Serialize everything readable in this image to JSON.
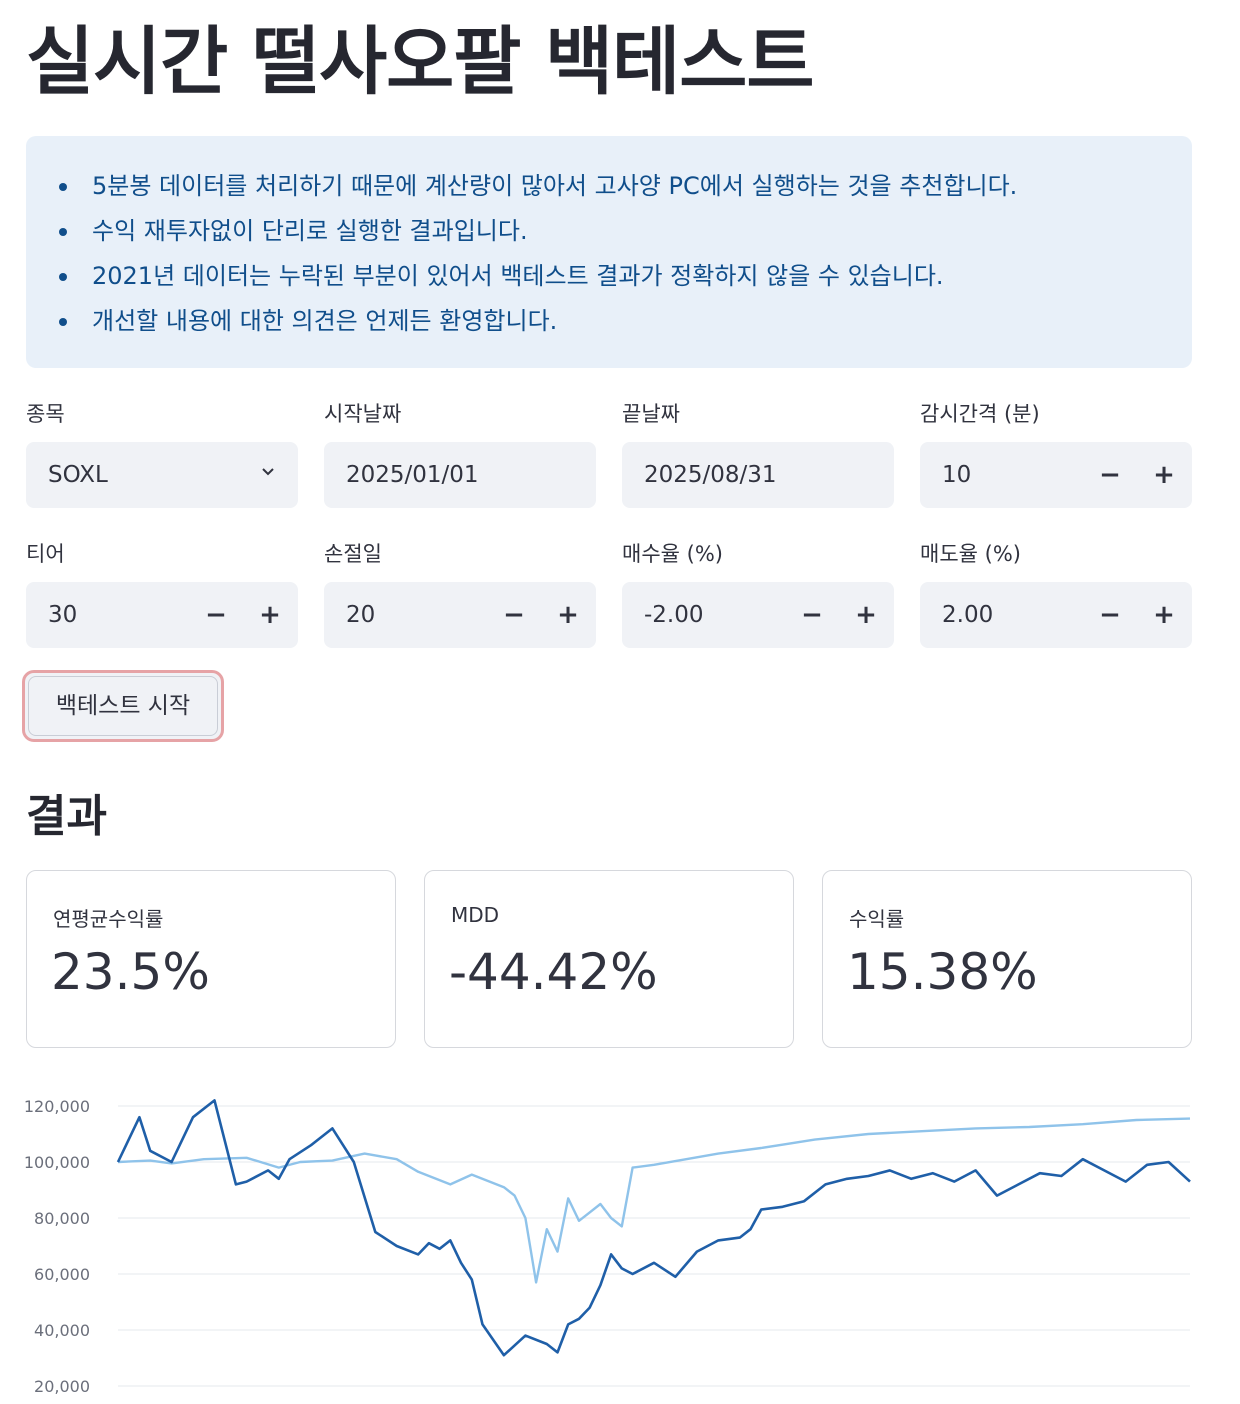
{
  "page": {
    "title": "실시간 떨사오팔 백테스트"
  },
  "info": {
    "items": [
      "5분봉 데이터를 처리하기 때문에 계산량이 많아서 고사양 PC에서 실행하는 것을 추천합니다.",
      "수익 재투자없이 단리로 실행한 결과입니다.",
      "2021년 데이터는 누락된 부분이 있어서 백테스트 결과가 정확하지 않을 수 있습니다.",
      "개선할 내용에 대한 의견은 언제든 환영합니다."
    ]
  },
  "form": {
    "ticker": {
      "label": "종목",
      "value": "SOXL"
    },
    "start_date": {
      "label": "시작날짜",
      "value": "2025/01/01"
    },
    "end_date": {
      "label": "끝날짜",
      "value": "2025/08/31"
    },
    "interval": {
      "label": "감시간격 (분)",
      "value": "10"
    },
    "tiers": {
      "label": "티어",
      "value": "30"
    },
    "stop_days": {
      "label": "손절일",
      "value": "20"
    },
    "buy_rate": {
      "label": "매수율 (%)",
      "value": "-2.00"
    },
    "sell_rate": {
      "label": "매도율 (%)",
      "value": "2.00"
    },
    "minus_glyph": "−",
    "plus_glyph": "+"
  },
  "actions": {
    "run_label": "백테스트 시작"
  },
  "results": {
    "title": "결과",
    "metrics": [
      {
        "label": "연평균수익률",
        "value": "23.5%"
      },
      {
        "label": "MDD",
        "value": "-44.42%"
      },
      {
        "label": "수익률",
        "value": "15.38%"
      }
    ]
  },
  "chart_data": {
    "type": "line",
    "ylim": [
      20000,
      120000
    ],
    "yticks": [
      "120,000",
      "100,000",
      "80,000",
      "60,000",
      "40,000",
      "20,000"
    ],
    "ytick_values": [
      120000,
      100000,
      80000,
      60000,
      40000,
      20000
    ],
    "grid": true,
    "series": [
      {
        "color": "#8fc3ea",
        "x": [
          0,
          0.03,
          0.05,
          0.08,
          0.12,
          0.15,
          0.17,
          0.2,
          0.23,
          0.26,
          0.28,
          0.31,
          0.33,
          0.36,
          0.37,
          0.38,
          0.39,
          0.4,
          0.41,
          0.42,
          0.43,
          0.44,
          0.45,
          0.46,
          0.47,
          0.48,
          0.5,
          0.53,
          0.56,
          0.6,
          0.65,
          0.7,
          0.75,
          0.8,
          0.85,
          0.9,
          0.95,
          1.0
        ],
        "y": [
          100000,
          100500,
          99500,
          101000,
          101500,
          98000,
          100000,
          100500,
          103000,
          101000,
          96500,
          92000,
          95500,
          91000,
          88000,
          80000,
          57000,
          76000,
          68000,
          87000,
          79000,
          82000,
          85000,
          80000,
          77000,
          98000,
          99000,
          101000,
          103000,
          105000,
          108000,
          110000,
          111000,
          112000,
          112500,
          113500,
          115000,
          115500
        ]
      },
      {
        "color": "#1f5fa8",
        "x": [
          0,
          0.02,
          0.03,
          0.05,
          0.07,
          0.09,
          0.11,
          0.12,
          0.14,
          0.15,
          0.16,
          0.18,
          0.2,
          0.22,
          0.24,
          0.26,
          0.28,
          0.29,
          0.3,
          0.31,
          0.32,
          0.33,
          0.34,
          0.36,
          0.38,
          0.4,
          0.41,
          0.42,
          0.43,
          0.44,
          0.45,
          0.46,
          0.47,
          0.48,
          0.5,
          0.52,
          0.54,
          0.56,
          0.58,
          0.59,
          0.6,
          0.62,
          0.64,
          0.66,
          0.68,
          0.7,
          0.72,
          0.74,
          0.76,
          0.78,
          0.8,
          0.82,
          0.84,
          0.86,
          0.88,
          0.9,
          0.92,
          0.94,
          0.96,
          0.98,
          1.0
        ],
        "y": [
          100000,
          116000,
          104000,
          100000,
          116000,
          122000,
          92000,
          93000,
          97000,
          94000,
          101000,
          106000,
          112000,
          100000,
          75000,
          70000,
          67000,
          71000,
          69000,
          72000,
          64000,
          58000,
          42000,
          31000,
          38000,
          35000,
          32000,
          42000,
          44000,
          48000,
          56000,
          67000,
          62000,
          60000,
          64000,
          59000,
          68000,
          72000,
          73000,
          76000,
          83000,
          84000,
          86000,
          92000,
          94000,
          95000,
          97000,
          94000,
          96000,
          93000,
          97000,
          88000,
          92000,
          96000,
          95000,
          101000,
          97000,
          93000,
          99000,
          100000,
          93000
        ]
      }
    ]
  }
}
